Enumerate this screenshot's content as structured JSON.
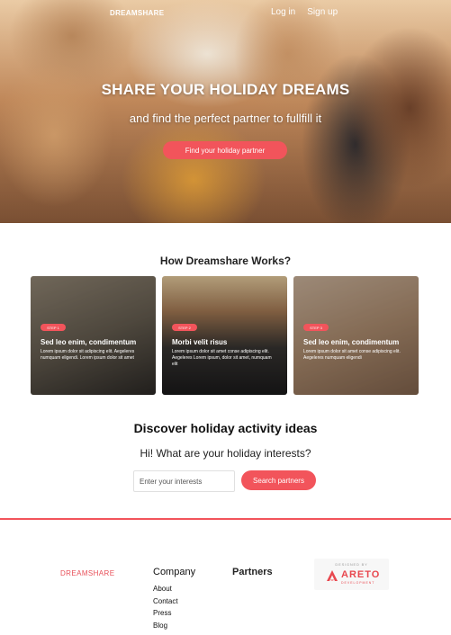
{
  "nav": {
    "logo": "DREAMSHARE",
    "login": "Log in",
    "signup": "Sign up"
  },
  "hero": {
    "title": "SHARE YOUR HOLIDAY DREAMS",
    "subtitle": "and find the perfect partner to fullfill it",
    "cta": "Find your holiday partner"
  },
  "how": {
    "title": "How Dreamshare Works?",
    "cards": [
      {
        "badge": "STEP 1",
        "title": "Sed leo enim, condimentum",
        "body": "Lorem ipsum dolor sit adipiscing elit. Aegeleres numquam eligendi. Lorem ipsum dolor sit amet"
      },
      {
        "badge": "STEP 2",
        "title": "Morbi velit risus",
        "body": "Lorem ipsum dolor sit amet conse adipiscing elit. Aegeleres Lorem ipsum, dolor sit amet, numquam elit"
      },
      {
        "badge": "STEP 3",
        "title": "Sed leo enim, condimentum",
        "body": "Lorem ipsum dolor sit amet conse adipiscing elit. Aegeleres numquam eligendi"
      }
    ]
  },
  "discover": {
    "title": "Discover holiday activity ideas",
    "subtitle": "Hi! What are your holiday interests?",
    "input_placeholder": "Enter your interests",
    "button": "Search partners"
  },
  "footer": {
    "logo": "DREAMSHARE",
    "company_heading": "Company",
    "company_links": [
      "About",
      "Contact",
      "Press",
      "Blog"
    ],
    "partners_heading": "Partners",
    "partner": {
      "designed_by": "DESIGNED BY",
      "name": "ARETO",
      "sub": "DEVELOPMENT"
    }
  },
  "colors": {
    "accent": "#f2545b",
    "text": "#222222",
    "footer_logo": "#e85059"
  }
}
